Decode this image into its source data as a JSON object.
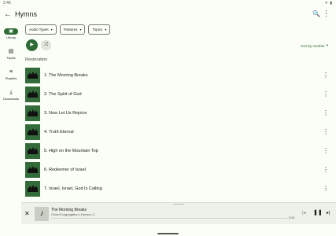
{
  "status": {
    "time": "2:46",
    "icons": "▾ ▮"
  },
  "appbar": {
    "back_icon": "←",
    "title": "Hymns",
    "search_icon": "🔍",
    "more_icon": "⋮"
  },
  "filters": [
    {
      "label": "Audio Types",
      "caret": "▾"
    },
    {
      "label": "Features",
      "caret": "▾"
    },
    {
      "label": "Topics",
      "caret": "▾"
    }
  ],
  "rail": [
    {
      "label": "Library",
      "icon": "▣"
    },
    {
      "label": "Topics",
      "icon": "▤"
    },
    {
      "label": "Playlists",
      "icon": "≡"
    },
    {
      "label": "Downloads",
      "icon": "⤓"
    }
  ],
  "controls": {
    "play_icon": "▶",
    "shuffle_icon": "⤮",
    "sort_label": "Sort by number",
    "sort_caret": "▾"
  },
  "section_title": "Restoration",
  "songs": [
    {
      "label": "1. The Morning Breaks"
    },
    {
      "label": "2. The Spirit of God"
    },
    {
      "label": "3. Now Let Us Rejoice"
    },
    {
      "label": "4. Truth Eternal"
    },
    {
      "label": "5. High on the Mountain Top"
    },
    {
      "label": "6. Redeemer of Israel"
    },
    {
      "label": "7. Israel, Israel, God Is Calling"
    }
  ],
  "player": {
    "close_icon": "✕",
    "art_icon": "♪",
    "title": "The Morning Breaks",
    "subtitle": "Choir/Congregation | Hymns | 1",
    "time": "3:51",
    "progress": 0,
    "prev_icon": "|◂",
    "pause_icon": "❚❚",
    "next_icon": "▸|"
  },
  "colors": {
    "accent": "#2e6b37",
    "thumb": "#336b3a"
  }
}
